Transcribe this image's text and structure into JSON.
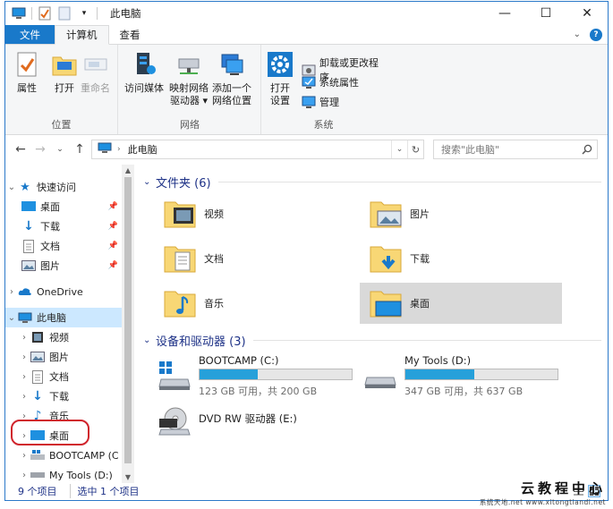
{
  "window": {
    "title": "此电脑",
    "controls": {
      "minimize": "—",
      "maximize": "☐",
      "close": "✕"
    }
  },
  "tabs": [
    {
      "label": "文件"
    },
    {
      "label": "计算机"
    },
    {
      "label": "查看"
    }
  ],
  "ribbon": {
    "groups": [
      {
        "label": "位置"
      },
      {
        "label": "网络"
      },
      {
        "label": "系统"
      }
    ],
    "location": {
      "properties": "属性",
      "open": "打开",
      "rename": "重命名"
    },
    "network": {
      "media_line1": "访问媒体",
      "map_line1": "映射网络",
      "map_line2": "驱动器 ▾",
      "add_line1": "添加一个",
      "add_line2": "网络位置"
    },
    "system": {
      "settings_line1": "打开",
      "settings_line2": "设置",
      "uninstall": "卸载或更改程序",
      "sysprops": "系统属性",
      "manage": "管理"
    }
  },
  "address": {
    "path": "此电脑",
    "search_placeholder": "搜索\"此电脑\""
  },
  "navpane": {
    "quick_access": "快速访问",
    "quick": [
      "桌面",
      "下载",
      "文档",
      "图片"
    ],
    "onedrive": "OneDrive",
    "thispc": "此电脑",
    "pc_items": [
      "视频",
      "图片",
      "文档",
      "下载",
      "音乐",
      "桌面",
      "BOOTCAMP (C",
      "My Tools (D:)"
    ]
  },
  "content": {
    "folders_header": "文件夹 (6)",
    "folders": [
      "视频",
      "图片",
      "文档",
      "下载",
      "音乐",
      "桌面"
    ],
    "drives_header": "设备和驱动器 (3)",
    "drives": [
      {
        "name": "BOOTCAMP (C:)",
        "size": "123 GB 可用，共 200 GB",
        "used_fraction": 0.385
      },
      {
        "name": "My Tools (D:)",
        "size": "347 GB 可用，共 637 GB",
        "used_fraction": 0.455
      },
      {
        "name": "DVD RW 驱动器 (E:)"
      }
    ]
  },
  "status": {
    "count": "9 个项目",
    "selected": "选中 1 个项目"
  },
  "watermark": {
    "line1": "云教程中心",
    "line2": "系统天地.net  www.xitongtiandi.net"
  },
  "colors": {
    "accent": "#1979ca",
    "selection": "#cce8ff",
    "drive_fill": "#26a0da",
    "folder": "#f8d775",
    "highlight_circle": "#d0242c"
  }
}
